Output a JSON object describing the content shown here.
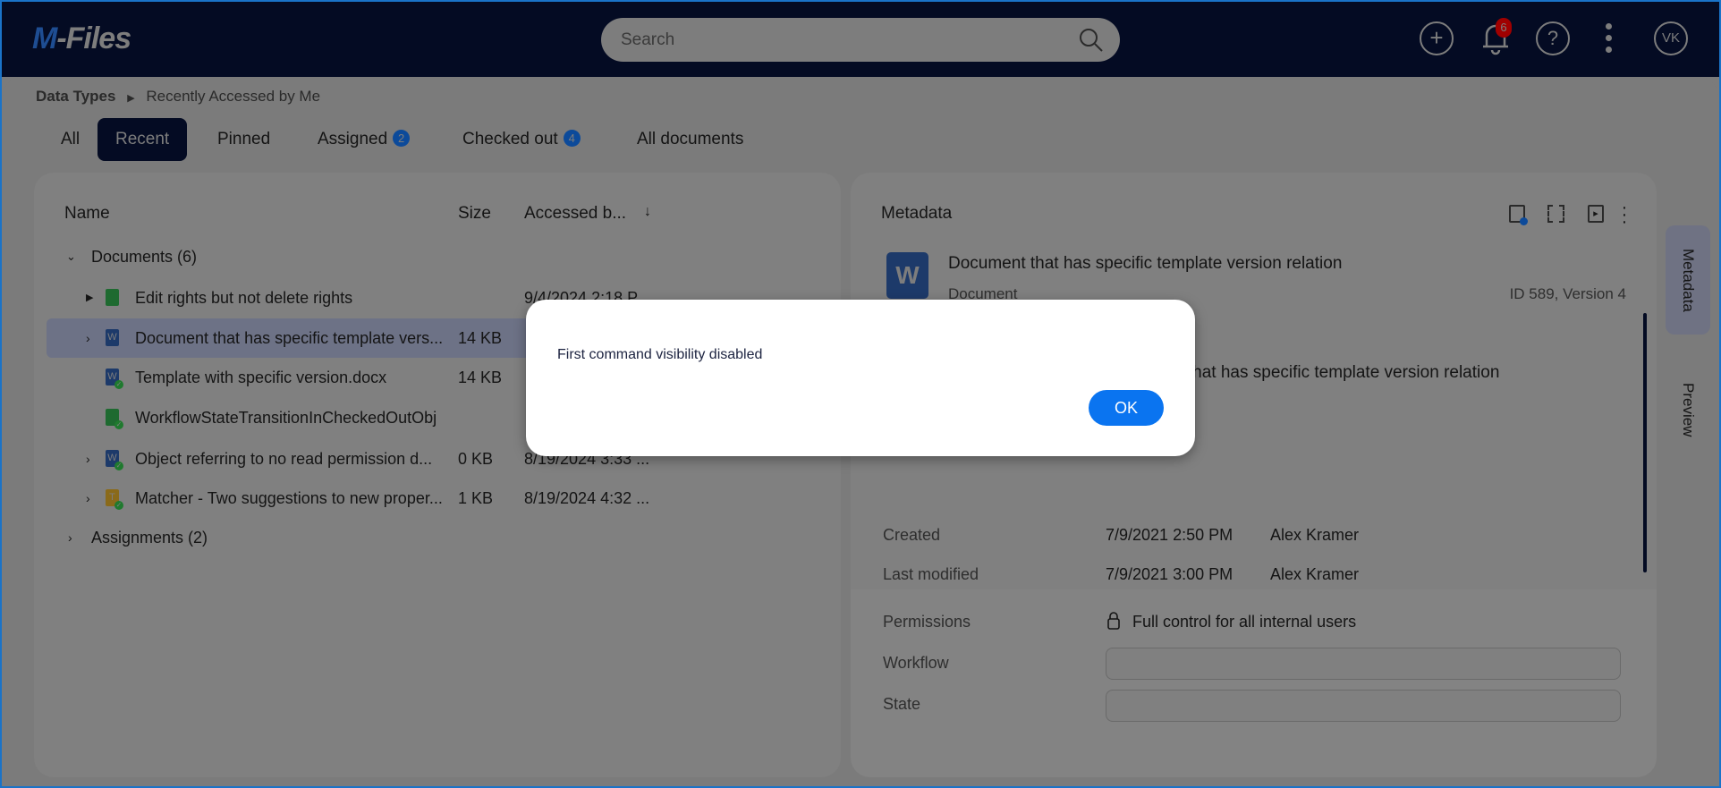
{
  "app": {
    "logo": "M-Files",
    "search_placeholder": "Search",
    "notification_count": "6",
    "avatar_initials": "VK"
  },
  "breadcrumb": {
    "root": "Data Types",
    "current": "Recently Accessed by Me"
  },
  "tabs": [
    {
      "label": "All"
    },
    {
      "label": "Recent",
      "selected": true
    },
    {
      "label": "Pinned"
    },
    {
      "label": "Assigned",
      "badge": "2"
    },
    {
      "label": "Checked out",
      "badge": "4"
    },
    {
      "label": "All documents"
    }
  ],
  "list": {
    "columns": {
      "name": "Name",
      "size": "Size",
      "accessed": "Accessed b...",
      "sort_icon": "arrow-down-icon"
    },
    "groups": [
      {
        "label": "Documents (6)",
        "expanded": true
      },
      {
        "label": "Assignments (2)",
        "expanded": false
      }
    ],
    "rows": [
      {
        "name": "Edit rights but not delete rights",
        "size": "",
        "accessed": "9/4/2024 2:18 P",
        "icon": "green-document-icon"
      },
      {
        "name": "Document that has specific template vers...",
        "size": "14 KB",
        "accessed": "",
        "icon": "word-icon",
        "selected": true
      },
      {
        "name": "Template with specific version.docx",
        "size": "14 KB",
        "accessed": "",
        "icon": "word-checked-icon"
      },
      {
        "name": "WorkflowStateTransitionInCheckedOutObj",
        "size": "",
        "accessed": "",
        "icon": "green-document-checked-icon"
      },
      {
        "name": "Object referring to no read permission d...",
        "size": "0 KB",
        "accessed": "8/19/2024 3:33 ...",
        "icon": "word-checked-icon"
      },
      {
        "name": "Matcher - Two suggestions to new proper...",
        "size": "1 KB",
        "accessed": "8/19/2024 4:32 ...",
        "icon": "template-checked-icon"
      }
    ]
  },
  "metadata": {
    "title": "Metadata",
    "object_title": "Document that has specific template version relation",
    "object_type": "Document",
    "id_version": "ID 589, Version 4",
    "name_value": "Document that has specific template version relation",
    "created_label": "Created",
    "created_date": "7/9/2021 2:50 PM",
    "created_by": "Alex Kramer",
    "modified_label": "Last modified",
    "modified_date": "7/9/2021 3:00 PM",
    "modified_by": "Alex Kramer",
    "permissions_label": "Permissions",
    "permissions_value": "Full control for all internal users",
    "workflow_label": "Workflow",
    "workflow_value": "",
    "state_label": "State",
    "state_value": ""
  },
  "side_tabs": {
    "metadata": "Metadata",
    "preview": "Preview"
  },
  "dialog": {
    "message": "First command visibility disabled",
    "ok_label": "OK"
  },
  "colors": {
    "header": "#040b23",
    "accent": "#0a74f0",
    "notification": "#a00000"
  }
}
